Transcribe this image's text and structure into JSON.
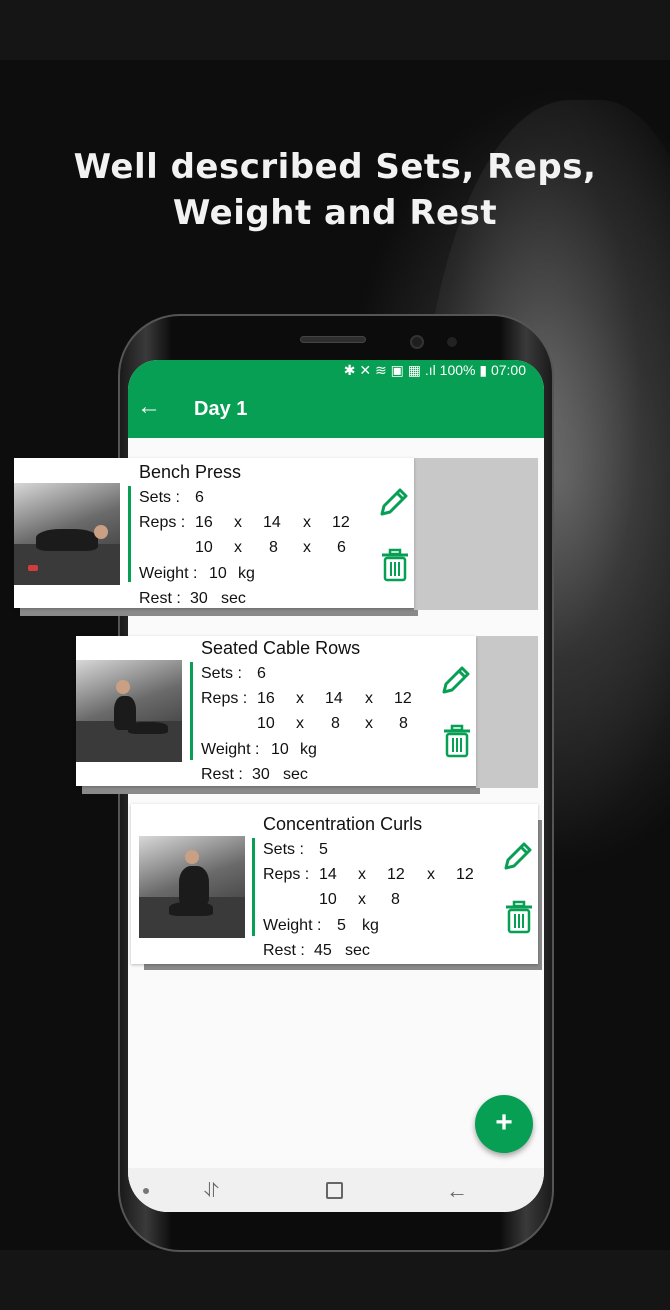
{
  "headline": {
    "line1": "Well described Sets, Reps,",
    "line2": "Weight and Rest"
  },
  "status_bar": {
    "text": "✱ ✕ ≋ ▣ ▦ .ıl 100% ▮ 07:00"
  },
  "app_bar": {
    "title": "Day 1"
  },
  "labels": {
    "sets": "Sets :",
    "reps": "Reps :",
    "weight": "Weight :",
    "rest": "Rest :",
    "x": "x",
    "kg": "kg",
    "sec": "sec"
  },
  "exercises": [
    {
      "name": "Bench Press",
      "sets": "6",
      "reps_row1": [
        "16",
        "14",
        "12"
      ],
      "reps_row2": [
        "10",
        "8",
        "6"
      ],
      "weight": "10",
      "rest": "30"
    },
    {
      "name": "Seated Cable Rows",
      "sets": "6",
      "reps_row1": [
        "16",
        "14",
        "12"
      ],
      "reps_row2": [
        "10",
        "8",
        "8"
      ],
      "weight": "10",
      "rest": "30"
    },
    {
      "name": "Concentration Curls",
      "sets": "5",
      "reps_row1": [
        "14",
        "12",
        "12"
      ],
      "reps_row2": [
        "10",
        "8"
      ],
      "weight": "5",
      "rest": "45"
    }
  ],
  "fab": {
    "label": "+"
  },
  "colors": {
    "accent": "#079f53",
    "background": "#0b0b0b"
  }
}
